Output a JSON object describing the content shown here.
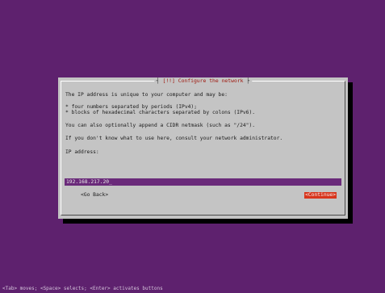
{
  "dialog": {
    "title": "Configure the network",
    "title_marker": "[!!]",
    "line1": "The IP address is unique to your computer and may be:",
    "bullet1": "* four numbers separated by periods (IPv4);",
    "bullet2": "* blocks of hexadecimal characters separated by colons (IPv6).",
    "line2": "You can also optionally append a CIDR netmask (such as \"/24\").",
    "line3": "If you don't know what to use here, consult your network administrator.",
    "field_label": "IP address:",
    "field_value": "192.168.217.20_",
    "back_label": "<Go Back>",
    "continue_label": "<Continue>"
  },
  "footer": {
    "help": "<Tab> moves; <Space> selects; <Enter> activates buttons"
  },
  "colors": {
    "background": "#5e216e",
    "dialog": "#c4c4c4",
    "accent": "#d8351c"
  }
}
